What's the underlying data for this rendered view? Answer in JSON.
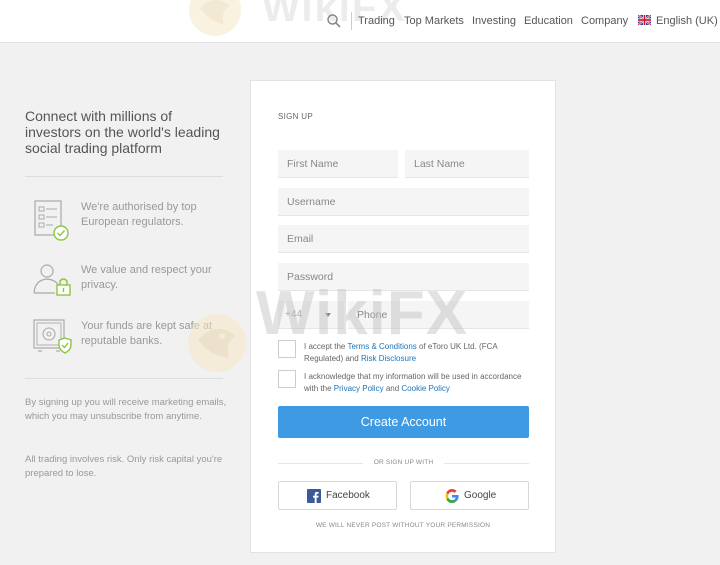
{
  "header": {
    "watermark_text": "WikiFX",
    "nav": [
      "Trading",
      "Top Markets",
      "Investing",
      "Education",
      "Company"
    ],
    "language": "English (UK)"
  },
  "left": {
    "headline": "Connect with millions of investors on the world's leading social trading platform",
    "features": [
      "We're authorised by top European regulators.",
      "We value and respect your privacy.",
      "Your funds are kept safe at reputable banks."
    ],
    "disclaimer_1": "By signing up you will receive marketing emails, which you may unsubscribe from anytime.",
    "disclaimer_2": "All trading involves risk. Only risk capital you're prepared to lose."
  },
  "form": {
    "title": "SIGN UP",
    "first_name_placeholder": "First Name",
    "last_name_placeholder": "Last Name",
    "username_placeholder": "Username",
    "email_placeholder": "Email",
    "password_placeholder": "Password",
    "phone_prefix": "+44",
    "phone_placeholder": "Phone",
    "terms": {
      "pre": "I accept the ",
      "link1": "Terms & Conditions",
      "mid": " of eToro UK Ltd. (FCA Regulated) and ",
      "link2": "Risk Disclosure"
    },
    "privacy": {
      "pre": "I acknowledge that my information will be used in accordance with the ",
      "link1": "Privacy Policy",
      "mid": " and ",
      "link2": "Cookie Policy"
    },
    "create_label": "Create Account",
    "or_text": "OR SIGN UP WITH",
    "facebook_label": "Facebook",
    "google_label": "Google",
    "never_post": "WE WILL NEVER POST WITHOUT YOUR PERMISSION"
  },
  "colors": {
    "accent": "#3d9ae3",
    "link": "#1b75bb",
    "facebook": "#3b5998"
  }
}
